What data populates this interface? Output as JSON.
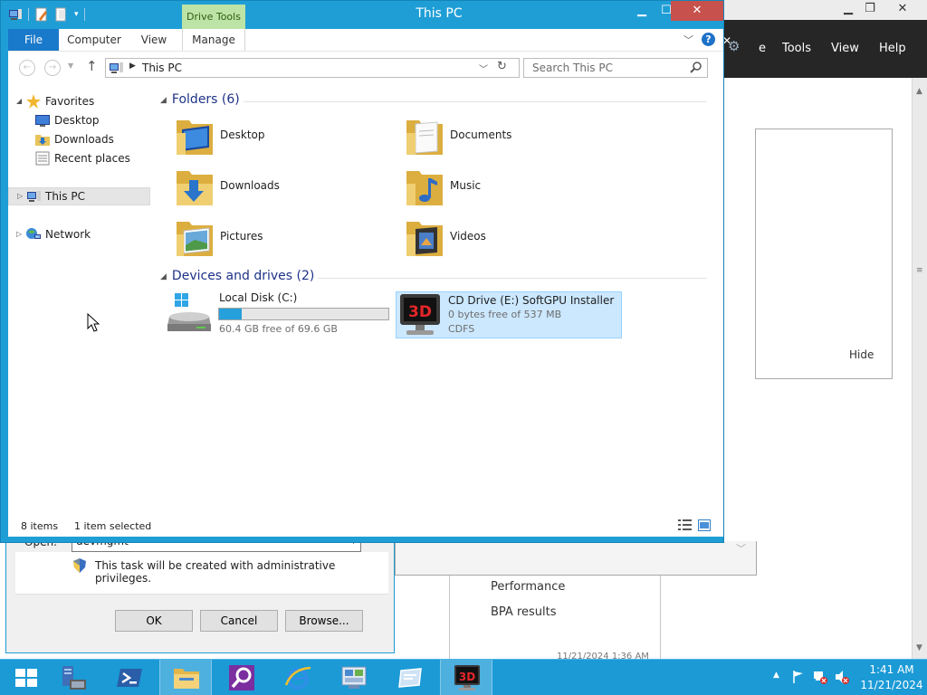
{
  "window": {
    "title": "This PC",
    "context_tab": "Drive Tools",
    "minimize": "▁",
    "maximize": "☐",
    "close": "✕"
  },
  "ribbon": {
    "tabs": [
      "File",
      "Computer",
      "View",
      "Manage"
    ],
    "help": "?"
  },
  "address": {
    "path": "This PC",
    "search_placeholder": "Search This PC"
  },
  "nav": {
    "favorites": "Favorites",
    "desktop": "Desktop",
    "downloads": "Downloads",
    "recent": "Recent places",
    "this_pc": "This PC",
    "network": "Network"
  },
  "folders": {
    "header": "Folders (6)",
    "items": [
      "Desktop",
      "Documents",
      "Downloads",
      "Music",
      "Pictures",
      "Videos"
    ]
  },
  "drives": {
    "header": "Devices and drives (2)",
    "c": {
      "name": "Local Disk (C:)",
      "free_text": "60.4 GB free of 69.6 GB",
      "used_fraction": 0.132
    },
    "e": {
      "name": "CD Drive (E:) SoftGPU Installer",
      "free_text": "0 bytes free of 537 MB",
      "fs": "CDFS",
      "icon_text": "3D"
    }
  },
  "status": {
    "count": "8 items",
    "selected": "1 item selected"
  },
  "background_app": {
    "menu": [
      "Tools",
      "View",
      "Help"
    ],
    "hide": "Hide",
    "tiles": [
      "Performance",
      "BPA results"
    ],
    "date": "11/21/2024 1:36 AM",
    "close_x": "✕"
  },
  "run_dialog": {
    "open_label": "Open:",
    "value": "devmgmt",
    "note": "This task will be created with administrative privileges.",
    "ok": "OK",
    "cancel": "Cancel",
    "browse": "Browse..."
  },
  "taskbar": {
    "time": "1:41 AM",
    "date": "11/21/2024"
  },
  "colors": {
    "accent": "#1f9ed6",
    "selection": "#cce8ff",
    "disk_bar": "#26a0da",
    "close_button": "#c7514c"
  }
}
